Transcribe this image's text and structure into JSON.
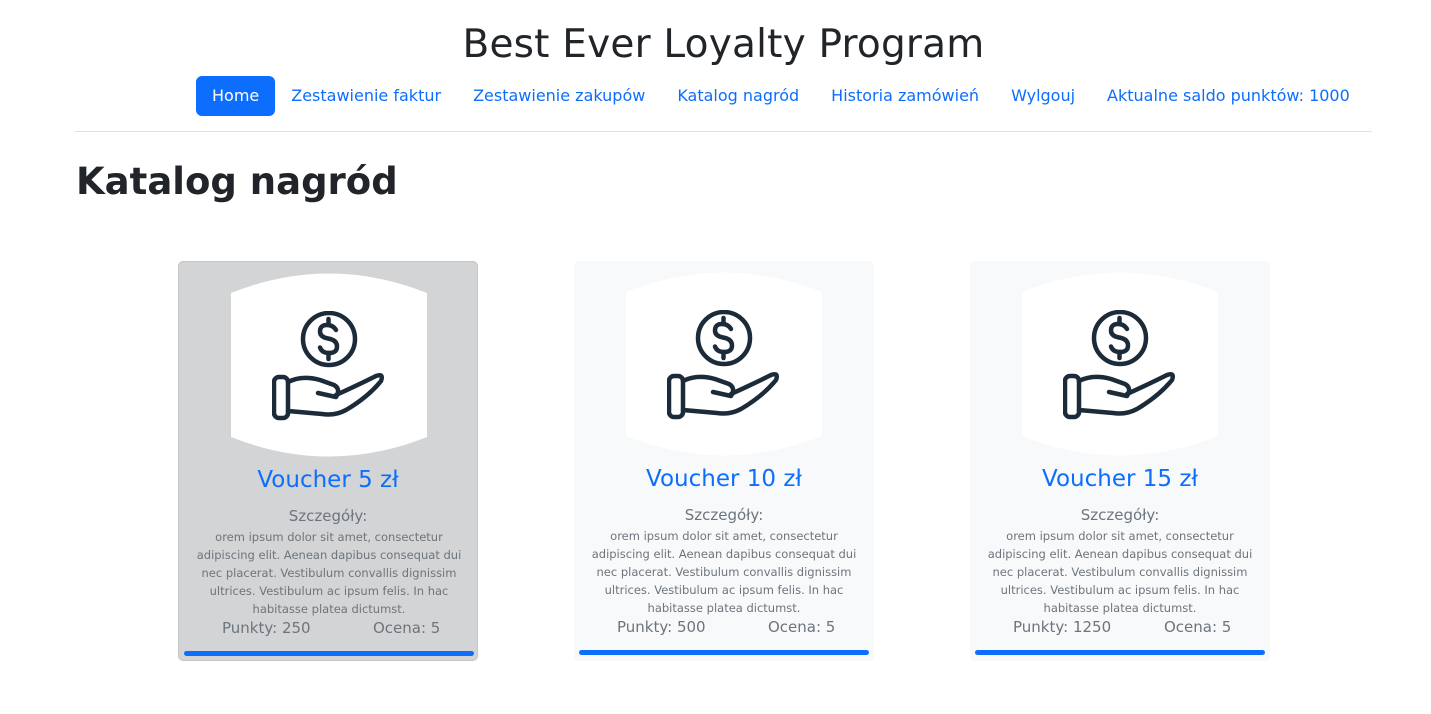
{
  "header": {
    "title": "Best Ever Loyalty Program"
  },
  "nav": {
    "items": [
      {
        "label": "Home"
      },
      {
        "label": "Zestawienie faktur"
      },
      {
        "label": "Zestawienie zakupów"
      },
      {
        "label": "Katalog nagród"
      },
      {
        "label": "Historia zamówień"
      },
      {
        "label": "Wylgouj"
      },
      {
        "label": "Aktualne saldo punktów: 1000"
      }
    ],
    "active_index": 0
  },
  "colors": {
    "accent": "#0d6efd",
    "text": "#212529",
    "muted": "#6c757d",
    "card_bg": "#f8f9fa",
    "card_hover_bg": "#d3d4d5",
    "icon_stroke": "#1c2b39"
  },
  "page": {
    "heading": "Katalog nagród"
  },
  "catalog": {
    "items": [
      {
        "title": "Voucher 5 zł",
        "details_label": "Szczegóły:",
        "description": "orem ipsum dolor sit amet, consectetur adipiscing elit. Aenean dapibus consequat dui nec placerat. Vestibulum convallis dignissim ultrices. Vestibulum ac ipsum felis. In hac habitasse platea dictumst.",
        "points": "Punkty: 250",
        "rating": "Ocena: 5",
        "icon": "hand-holding-dollar-icon"
      },
      {
        "title": "Voucher 10 zł",
        "details_label": "Szczegóły:",
        "description": "orem ipsum dolor sit amet, consectetur adipiscing elit. Aenean dapibus consequat dui nec placerat. Vestibulum convallis dignissim ultrices. Vestibulum ac ipsum felis. In hac habitasse platea dictumst.",
        "points": "Punkty: 500",
        "rating": "Ocena: 5",
        "icon": "hand-holding-dollar-icon"
      },
      {
        "title": "Voucher 15 zł",
        "details_label": "Szczegóły:",
        "description": "orem ipsum dolor sit amet, consectetur adipiscing elit. Aenean dapibus consequat dui nec placerat. Vestibulum convallis dignissim ultrices. Vestibulum ac ipsum felis. In hac habitasse platea dictumst.",
        "points": "Punkty: 1250",
        "rating": "Ocena: 5",
        "icon": "hand-holding-dollar-icon"
      }
    ]
  }
}
